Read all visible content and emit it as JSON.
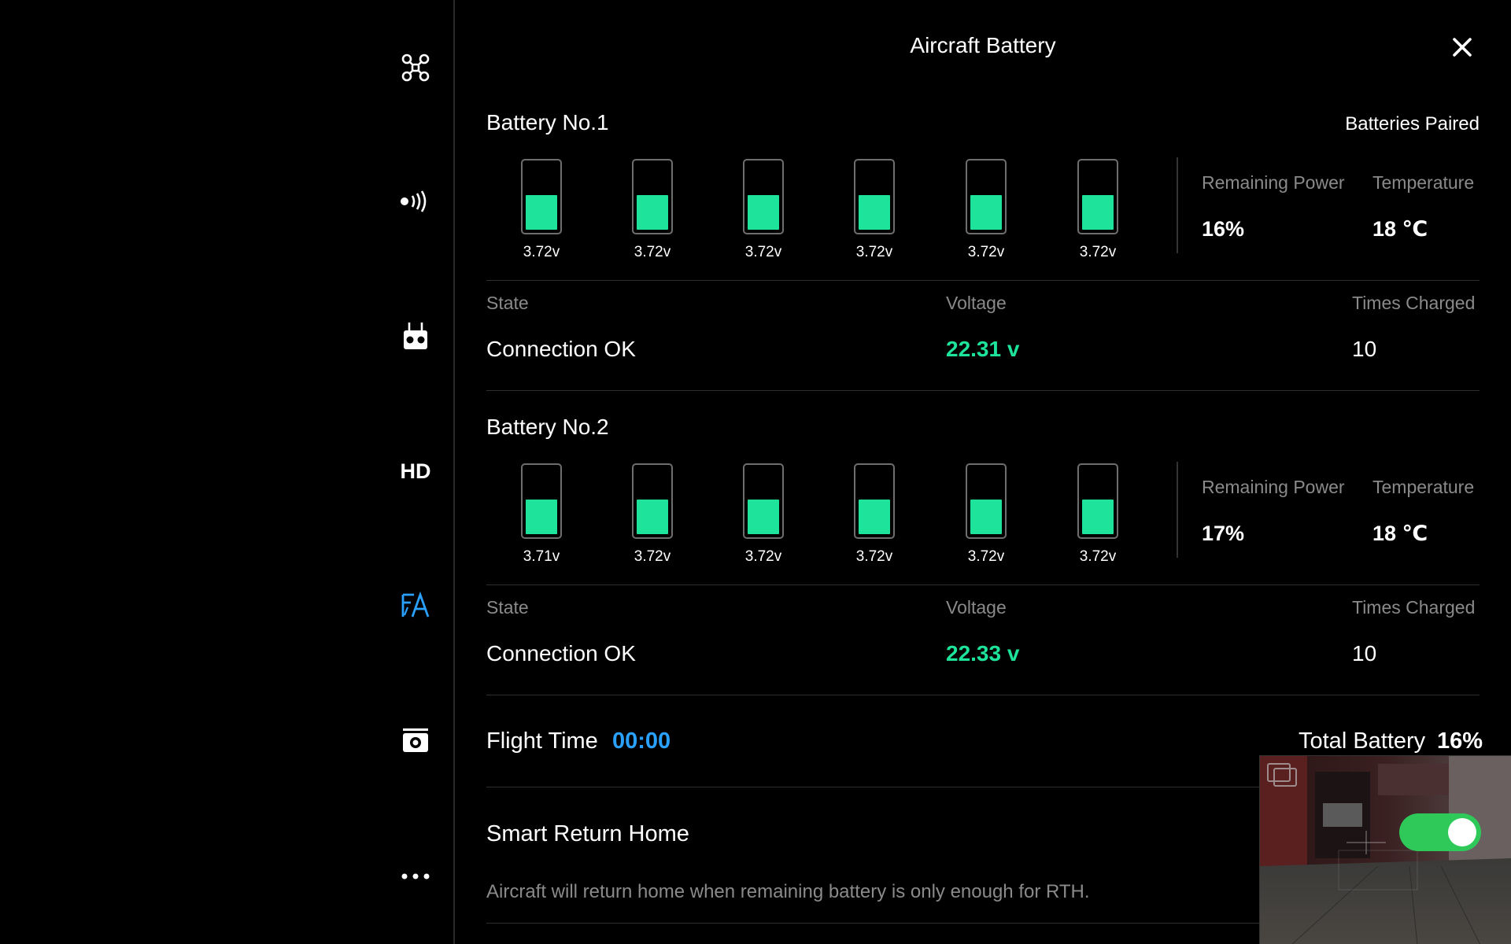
{
  "panel": {
    "title": "Aircraft Battery"
  },
  "sidebar": {
    "items": [
      {
        "icon": "drone-icon"
      },
      {
        "icon": "signal-icon"
      },
      {
        "icon": "remote-controller-icon"
      },
      {
        "icon": "hd-icon",
        "label": "HD"
      },
      {
        "icon": "battery-settings-icon",
        "active": true
      },
      {
        "icon": "camera-icon"
      },
      {
        "icon": "more-icon"
      }
    ]
  },
  "paired_status": "Batteries Paired",
  "batteries": [
    {
      "title": "Battery No.1",
      "cells": [
        {
          "voltage": "3.72v",
          "level": 0.52
        },
        {
          "voltage": "3.72v",
          "level": 0.52
        },
        {
          "voltage": "3.72v",
          "level": 0.52
        },
        {
          "voltage": "3.72v",
          "level": 0.52
        },
        {
          "voltage": "3.72v",
          "level": 0.52
        },
        {
          "voltage": "3.72v",
          "level": 0.52
        }
      ],
      "remaining_power_label": "Remaining Power",
      "remaining_power": "16%",
      "temperature_label": "Temperature",
      "temperature": "18 ℃",
      "state_label": "State",
      "state": "Connection OK",
      "voltage_label": "Voltage",
      "voltage": "22.31 v",
      "times_charged_label": "Times Charged",
      "times_charged": "10"
    },
    {
      "title": "Battery No.2",
      "cells": [
        {
          "voltage": "3.71v",
          "level": 0.52
        },
        {
          "voltage": "3.72v",
          "level": 0.52
        },
        {
          "voltage": "3.72v",
          "level": 0.52
        },
        {
          "voltage": "3.72v",
          "level": 0.52
        },
        {
          "voltage": "3.72v",
          "level": 0.52
        },
        {
          "voltage": "3.72v",
          "level": 0.52
        }
      ],
      "remaining_power_label": "Remaining Power",
      "remaining_power": "17%",
      "temperature_label": "Temperature",
      "temperature": "18 ℃",
      "state_label": "State",
      "state": "Connection OK",
      "voltage_label": "Voltage",
      "voltage": "22.33 v",
      "times_charged_label": "Times Charged",
      "times_charged": "10"
    }
  ],
  "flight_time_label": "Flight Time",
  "flight_time": "00:00",
  "total_battery_label": "Total Battery",
  "total_battery": "16%",
  "smart_return_home": {
    "label": "Smart Return Home",
    "description": "Aircraft will return home when remaining battery is only enough for RTH.",
    "enabled": true
  },
  "colors": {
    "accent_green": "#1ee39b",
    "accent_blue": "#2aa1ff",
    "toggle_on": "#2fc95a"
  }
}
